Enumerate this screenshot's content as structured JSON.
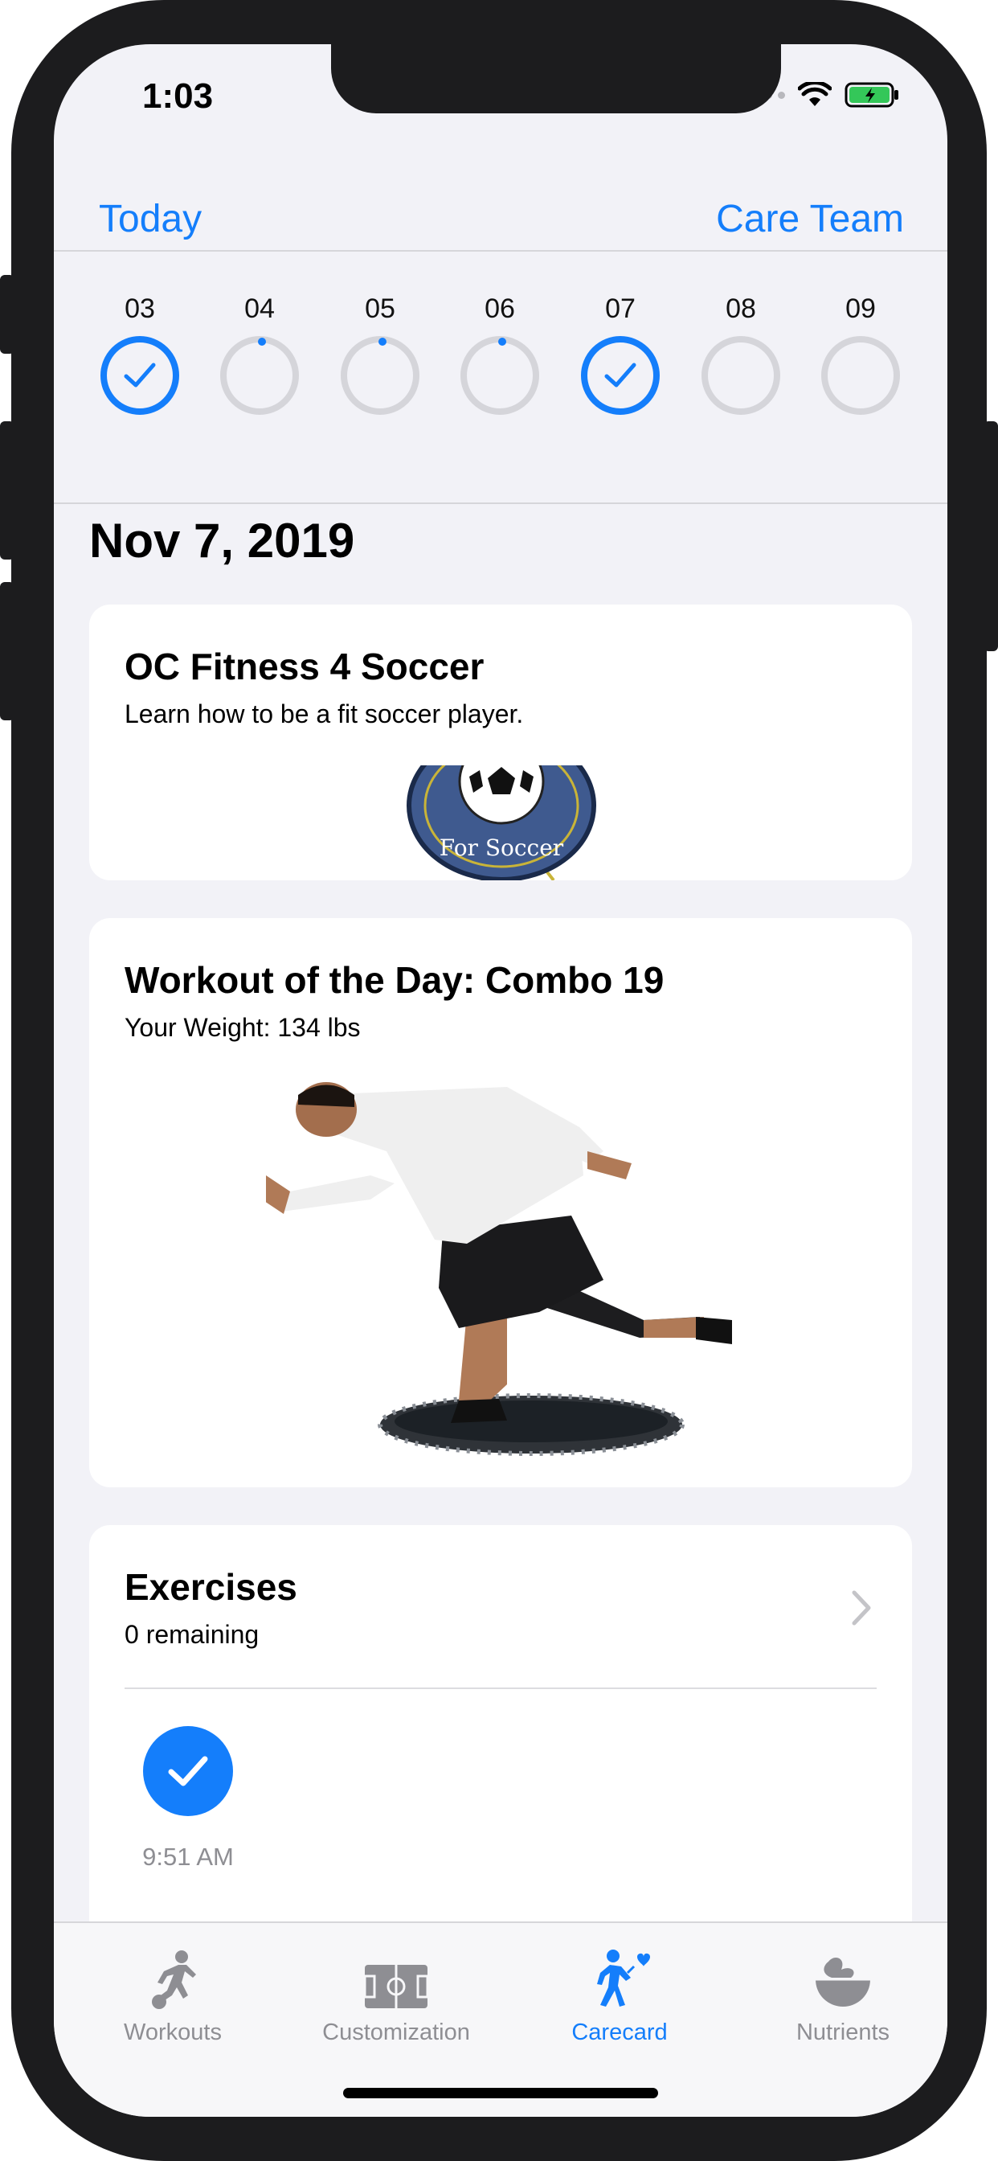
{
  "status": {
    "time": "1:03"
  },
  "nav": {
    "left": "Today",
    "right": "Care Team"
  },
  "week": [
    {
      "label": "03",
      "state": "done"
    },
    {
      "label": "04",
      "state": "pending"
    },
    {
      "label": "05",
      "state": "pending"
    },
    {
      "label": "06",
      "state": "pending"
    },
    {
      "label": "07",
      "state": "done"
    },
    {
      "label": "08",
      "state": "empty"
    },
    {
      "label": "09",
      "state": "empty"
    }
  ],
  "date_title": "Nov 7, 2019",
  "intro_card": {
    "title": "OC Fitness 4 Soccer",
    "subtitle": "Learn how to be a fit soccer player.",
    "logo_text": "For Soccer"
  },
  "workout_card": {
    "title": "Workout of the Day: Combo 19",
    "subtitle": "Your Weight: 134 lbs"
  },
  "exercises_card": {
    "title": "Exercises",
    "subtitle": "0 remaining",
    "completed_time": "9:51 AM"
  },
  "tabs": [
    {
      "label": "Workouts",
      "icon": "soccer-player-icon"
    },
    {
      "label": "Customization",
      "icon": "field-icon"
    },
    {
      "label": "Carecard",
      "icon": "walking-heart-icon"
    },
    {
      "label": "Nutrients",
      "icon": "bowl-icon"
    }
  ],
  "colors": {
    "accent": "#147efb",
    "inactive": "#8e8e93",
    "background": "#f2f2f7"
  }
}
